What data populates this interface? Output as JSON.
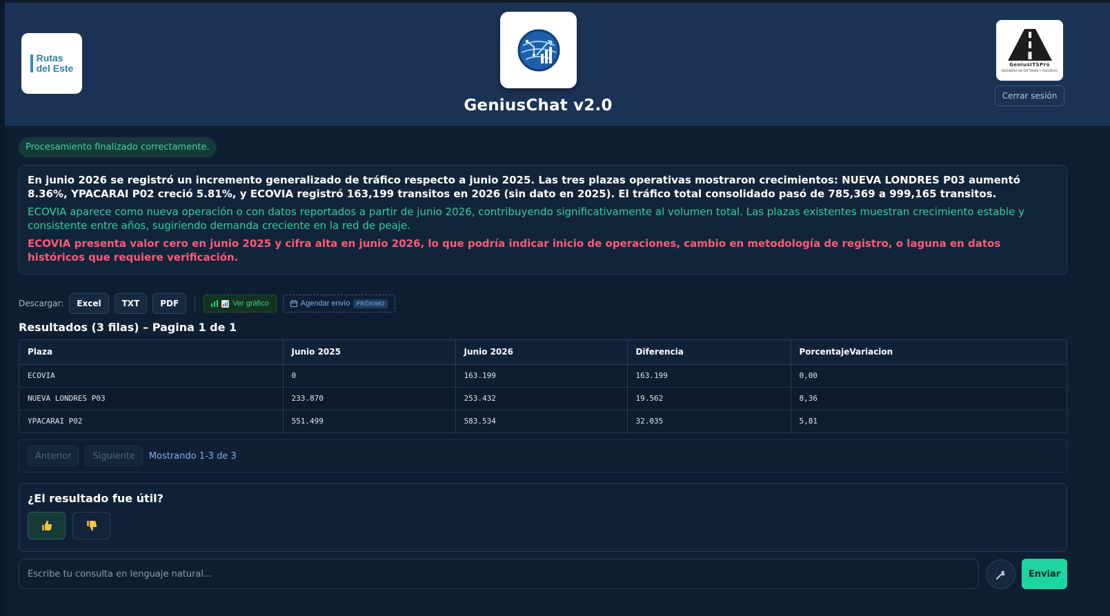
{
  "header": {
    "left_logo_text": [
      "Rutas",
      "del Este"
    ],
    "app_title": "GeniusChat v2.0",
    "right_logo_name": "GeniusITSPro",
    "right_logo_tagline": "INGENIERIA EN SOFTWARE Y ASESORIAS",
    "logout_label": "Cerrar sesión"
  },
  "status": {
    "message": "Procesamiento finalizado correctamente.",
    "color": "#46d5a4"
  },
  "summary": {
    "main": "En junio 2026 se registró un incremento generalizado de tráfico respecto a junio 2025. Las tres plazas operativas mostraron crecimientos: NUEVA LONDRES P03 aumentó 8.36%, YPACARAI P02 creció 5.81%, y ECOVIA registró 163,199 transitos en 2026 (sin dato en 2025). El tráfico total consolidado pasó de 785,369 a 999,165 transitos.",
    "insight": "ECOVIA aparece como nueva operación o con datos reportados a partir de junio 2026, contribuyendo significativamente al volumen total. Las plazas existentes muestran crecimiento estable y consistente entre años, sugiriendo demanda creciente en la red de peaje.",
    "alert": "ECOVIA presenta valor cero en junio 2025 y cifra alta en junio 2026, lo que podría indicar inicio de operaciones, cambio en metodología de registro, o laguna en datos históricos que requiere verificación.",
    "colors": {
      "insight": "#31d1a0",
      "alert": "#ff5b7a"
    }
  },
  "toolbar": {
    "download_label": "Descargar:",
    "excel": "Excel",
    "txt": "TXT",
    "pdf": "PDF",
    "chart_label": "Ver gráfico",
    "chart_icon": "bar-chart-icon",
    "schedule_label": "Agendar envío",
    "schedule_icon": "calendar-icon",
    "schedule_badge": "PRÓXIMO"
  },
  "results": {
    "title": "Resultados (3 filas) – Pagina 1 de 1",
    "columns": [
      "Plaza",
      "Junio 2025",
      "Junio 2026",
      "Diferencia",
      "PorcentajeVariacion"
    ],
    "rows": [
      [
        "ECOVIA",
        "0",
        "163.199",
        "163.199",
        "0,00"
      ],
      [
        "NUEVA LONDRES P03",
        "233.870",
        "253.432",
        "19.562",
        "8,36"
      ],
      [
        "YPACARAI P02",
        "551.499",
        "583.534",
        "32.035",
        "5,81"
      ]
    ]
  },
  "pagination": {
    "prev": "Anterior",
    "next": "Siguiente",
    "info": "Mostrando 1-3 de 3"
  },
  "feedback": {
    "question": "¿El resultado fue útil?",
    "up_icon": "thumbs-up-icon",
    "down_icon": "thumbs-down-icon"
  },
  "input": {
    "placeholder": "Escribe tu consulta en lenguaje natural...",
    "value": "",
    "tool_icon": "wrench-icon",
    "send_label": "Enviar",
    "accent": "#1fd4a0"
  }
}
